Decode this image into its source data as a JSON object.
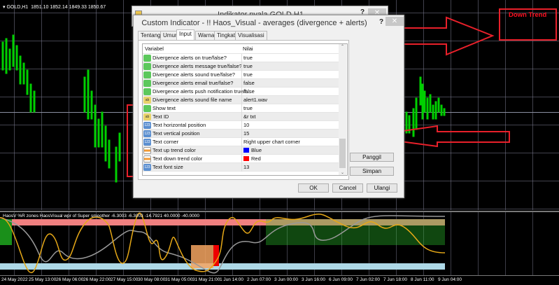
{
  "chart": {
    "symbol": "GOLD,H1",
    "ohlc": "1851.10 1852.14 1849.33 1850.67",
    "trend_label": "Down Trend",
    "trend_color": "#ff1020"
  },
  "back_dialog": {
    "title": "Indikator nyala GOLD.H1",
    "help": "?",
    "close": "✕"
  },
  "dialog": {
    "title": "Custom Indicator - !! Haos_Visual - averages (divergence + alerts)",
    "help": "?",
    "close": "✕",
    "tabs": [
      "Tentang",
      "Umum",
      "Input",
      "Warna",
      "Tingkat",
      "Visualisasi"
    ],
    "active_tab": "Input",
    "columns": [
      "Variabel",
      "Nilai"
    ],
    "rows": [
      {
        "type": "bool",
        "name": "Divergence alerts on true/false?",
        "value": "true"
      },
      {
        "type": "bool",
        "name": "Divergence alerts message true/false?",
        "value": "true"
      },
      {
        "type": "bool",
        "name": "Divergence alerts sound true/false?",
        "value": "true"
      },
      {
        "type": "bool",
        "name": "Divergence alerts email true/false?",
        "value": "false"
      },
      {
        "type": "bool",
        "name": "Divergence alerts push notification true/f...",
        "value": "false"
      },
      {
        "type": "str",
        "name": "Divergence alerts sound file name",
        "value": "alert1.wav"
      },
      {
        "type": "bool",
        "name": "Show text",
        "value": "true"
      },
      {
        "type": "str",
        "name": "Text ID",
        "value": "&r txt"
      },
      {
        "type": "int",
        "name": "Text horizontal position",
        "value": "10"
      },
      {
        "type": "int",
        "name": "Text vertical position",
        "value": "15"
      },
      {
        "type": "int",
        "name": "Text corner",
        "value": "Right upper chart corner"
      },
      {
        "type": "col",
        "name": "Text up trend color",
        "value": "Blue",
        "swatch": "#0000ff"
      },
      {
        "type": "col",
        "name": "Text down trend color",
        "value": "Red",
        "swatch": "#ff0000"
      },
      {
        "type": "int",
        "name": "Text font size",
        "value": "13"
      }
    ],
    "type_icons": {
      "bool": "",
      "str": "ab",
      "int": "123",
      "col": ""
    },
    "buttons": {
      "load": "Panggil",
      "save": "Simpan",
      "ok": "OK",
      "cancel": "Cancel",
      "reset": "Ulangi"
    }
  },
  "indicator": {
    "label": "HaosV  %R zones  HaosVisual wpr of Super smoother -6.3003 -6.3003 -14.7921 40.0000 -40.0000"
  },
  "time_axis": [
    "24 May 2022",
    "25 May 13:00",
    "26 May 06:00",
    "26 May 22:00",
    "27 May 15:00",
    "30 May 08:00",
    "31 May 05:00",
    "31 May 21:00",
    "1 Jun 14:00",
    "2 Jun 07:00",
    "3 Jun 00:00",
    "3 Jun 16:00",
    "6 Jun 09:00",
    "7 Jun 02:00",
    "7 Jun 18:00",
    "8 Jun 11:00",
    "9 Jun 04:00"
  ]
}
